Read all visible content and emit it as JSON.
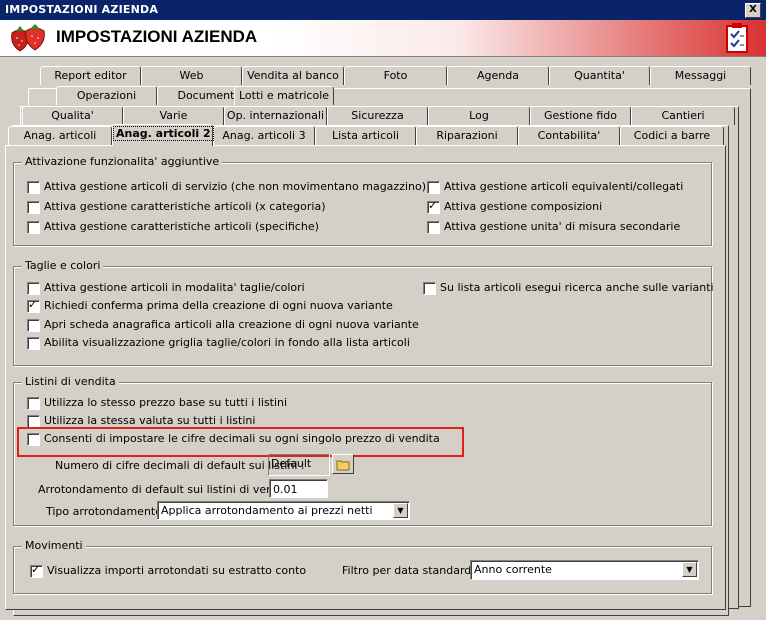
{
  "window": {
    "title": "IMPOSTAZIONI AZIENDA",
    "close_glyph": "X"
  },
  "header": {
    "title": "IMPOSTAZIONI AZIENDA",
    "logo_icon": "strawberries-icon",
    "clipboard_icon": "checklist-icon"
  },
  "tabs": {
    "row1": [
      "Report editor",
      "Web",
      "Vendita al banco",
      "Foto",
      "Agenda",
      "Quantita'",
      "Messaggi"
    ],
    "row2": [
      "Operazioni",
      "Documenti",
      "Lotti e matricole"
    ],
    "row3": [
      "Qualita'",
      "Varie",
      "Op. internazionali",
      "Sicurezza",
      "Log",
      "Gestione fido",
      "Cantieri"
    ],
    "row4": [
      "Anag. articoli",
      "Anag. articoli 2",
      "Anag. articoli 3",
      "Lista articoli",
      "Riparazioni",
      "Contabilita'",
      "Codici a barre"
    ],
    "selected": "Anag. articoli 2"
  },
  "groups": {
    "funzionalita": {
      "title": "Attivazione funzionalita' aggiuntive",
      "items": [
        {
          "label": "Attiva gestione articoli di servizio (che non movimentano magazzino)",
          "checked": false
        },
        {
          "label": "Attiva gestione caratteristiche articoli (x categoria)",
          "checked": false
        },
        {
          "label": "Attiva gestione caratteristiche articoli (specifiche)",
          "checked": false
        },
        {
          "label": "Attiva gestione articoli equivalenti/collegati",
          "checked": false
        },
        {
          "label": "Attiva gestione composizioni",
          "checked": true
        },
        {
          "label": "Attiva gestione unita' di misura secondarie",
          "checked": false
        }
      ]
    },
    "taglie": {
      "title": "Taglie e colori",
      "items": [
        {
          "label": "Attiva gestione articoli in modalita' taglie/colori",
          "checked": false
        },
        {
          "label": "Richiedi conferma prima della creazione di ogni nuova variante",
          "checked": true
        },
        {
          "label": "Apri scheda anagrafica articoli alla creazione di ogni nuova variante",
          "checked": false
        },
        {
          "label": "Abilita visualizzazione griglia taglie/colori in fondo alla lista articoli",
          "checked": false
        },
        {
          "label": "Su lista articoli esegui ricerca anche sulle varianti",
          "checked": false
        }
      ]
    },
    "listini": {
      "title": "Listini di vendita",
      "items": [
        {
          "label": "Utilizza lo stesso prezzo base su tutti i listini",
          "checked": false
        },
        {
          "label": "Utilizza la stessa valuta su tutti i listini",
          "checked": false
        },
        {
          "label": "Consenti di impostare le cifre decimali su ogni singolo prezzo di vendita",
          "checked": false
        }
      ],
      "decimali_label": "Numero di cifre decimali di default sui listini :",
      "decimali_value": "Default",
      "arrot_label": "Arrotondamento di default sui listini di vendita :",
      "arrot_value": "0.01",
      "tipo_label": "Tipo arrotondamento :",
      "tipo_value": "Applica arrotondamento ai prezzi netti"
    },
    "movimenti": {
      "title": "Movimenti",
      "item": {
        "label": "Visualizza importi arrotondati su estratto conto",
        "checked": true
      },
      "filtro_label": "Filtro per data standard :",
      "filtro_value": "Anno corrente"
    }
  },
  "colors": {
    "highlight": "#e0201c",
    "titlebar": "#0a246a",
    "header_red": "#d83232"
  }
}
